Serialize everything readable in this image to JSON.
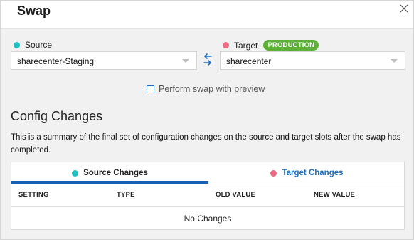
{
  "dialog": {
    "title": "Swap",
    "close_icon": "close-icon"
  },
  "source": {
    "label": "Source",
    "value": "sharecenter-Staging",
    "dot_color": "#1fbfbf"
  },
  "target": {
    "label": "Target",
    "badge": "PRODUCTION",
    "badge_color": "#5cb038",
    "value": "sharecenter",
    "dot_color": "#ef6b83"
  },
  "swap_icon": "swap-arrows-icon",
  "preview": {
    "label": "Perform swap with preview",
    "checked": false
  },
  "config": {
    "title": "Config Changes",
    "summary": "This is a summary of the final set of configuration changes on the source and target slots after the swap has completed.",
    "tabs": [
      {
        "label": "Source Changes",
        "active": true
      },
      {
        "label": "Target Changes",
        "active": false
      }
    ],
    "columns": [
      "SETTING",
      "TYPE",
      "OLD VALUE",
      "NEW VALUE"
    ],
    "empty_text": "No Changes"
  },
  "colors": {
    "accent": "#1a5fb4",
    "link": "#1e6fbf"
  }
}
